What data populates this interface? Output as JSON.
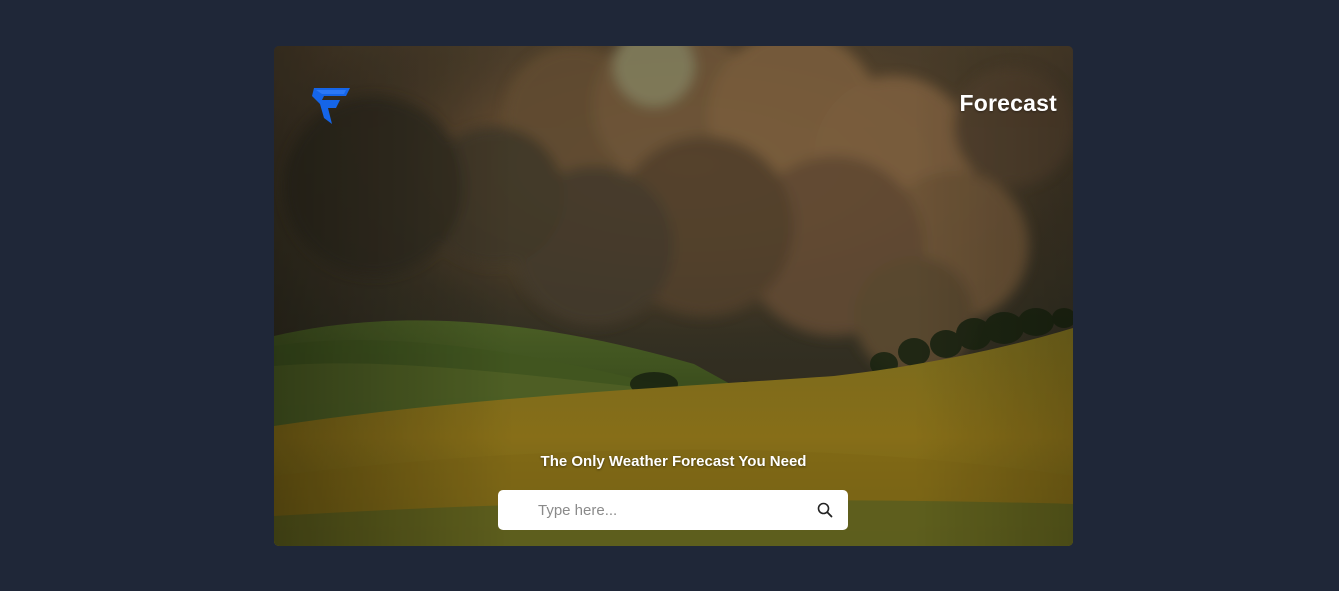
{
  "app": {
    "title": "Forecast",
    "logo_color": "#1565e8"
  },
  "hero": {
    "tagline": "The Only Weather Forecast You Need"
  },
  "search": {
    "placeholder": "Type here...",
    "value": "",
    "icon": "search-icon"
  },
  "colors": {
    "page_background": "#1f2738",
    "text": "#ffffff",
    "search_background": "#ffffff"
  }
}
